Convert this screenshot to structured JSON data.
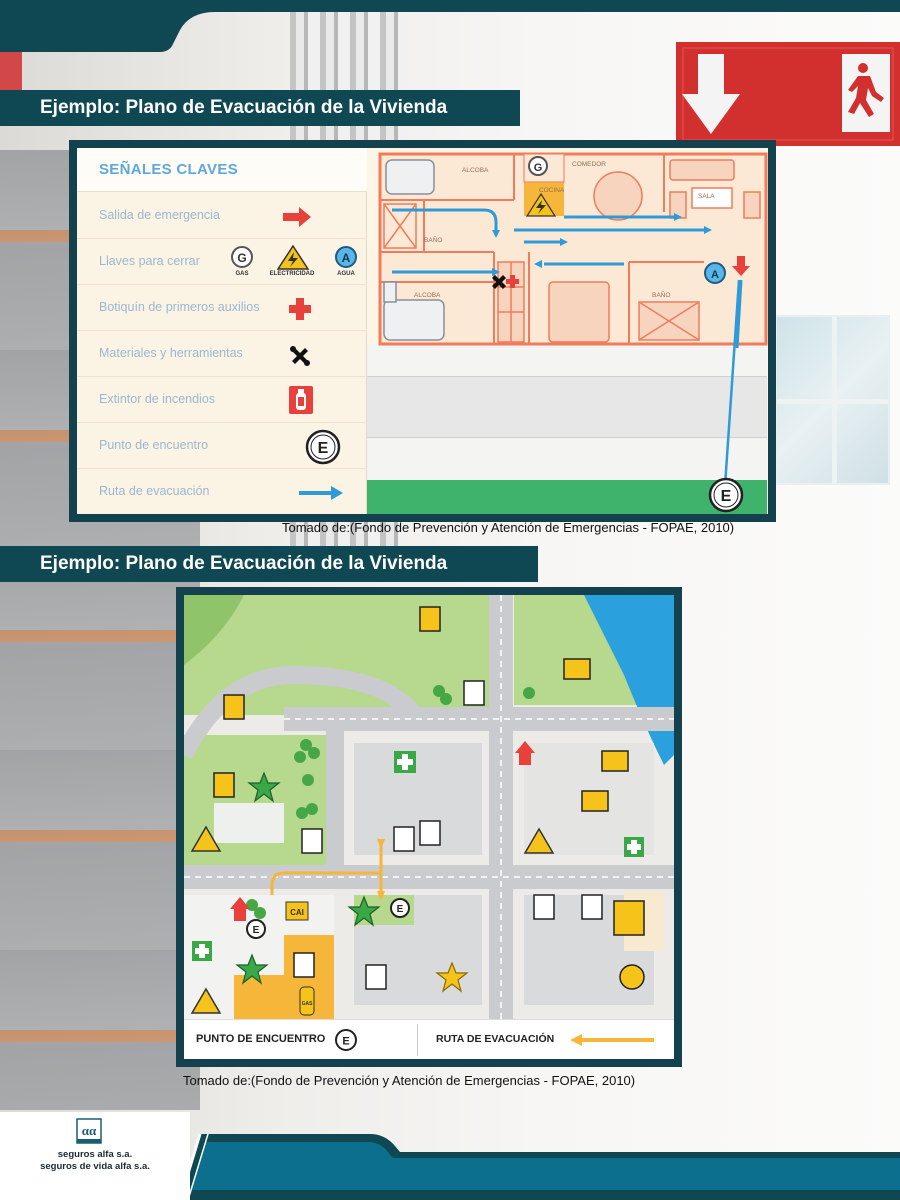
{
  "headers": {
    "section1_title": "Ejemplo: Plano de Evacuación de la Vivienda",
    "section2_title": "Ejemplo: Plano de Evacuación de la Vivienda"
  },
  "legend": {
    "title": "SEÑALES CLAVES",
    "items": [
      {
        "label": "Salida de emergencia",
        "icon": "red-arrow-icon"
      },
      {
        "label": "Llaves para cerrar",
        "icon": "shutoff-keys-icons",
        "sub": [
          "GAS",
          "ELECTRICIDAD",
          "AGUA"
        ]
      },
      {
        "label": "Botiquín de primeros auxilios",
        "icon": "first-aid-cross-icon"
      },
      {
        "label": "Materiales y herramientas",
        "icon": "tools-icon"
      },
      {
        "label": "Extintor de incendios",
        "icon": "fire-extinguisher-icon"
      },
      {
        "label": "Punto de encuentro",
        "icon": "meeting-point-icon",
        "glyph": "E"
      },
      {
        "label": "Ruta de evacuación",
        "icon": "evacuation-route-arrow-icon"
      }
    ]
  },
  "floorplan": {
    "rooms": [
      "ALCOBA",
      "COMEDOR",
      "COCINA",
      "SALA",
      "BAÑO",
      "BAÑO",
      "ALCOBA"
    ],
    "key_labels": {
      "gas": "G",
      "water": "A",
      "meeting": "E"
    }
  },
  "credits": {
    "credit1": "Tomado de:(Fondo de Prevención y Atención de Emergencias - FOPAE, 2010)",
    "credit2": "Tomado de:(Fondo de Prevención y Atención de Emergencias - FOPAE, 2010)"
  },
  "map": {
    "footer_left": "PUNTO DE ENCUENTRO",
    "footer_right": "RUTA DE EVACUACIÓN",
    "meeting_glyph": "E",
    "cai_label": "CAI",
    "gas_label": "GAS"
  },
  "brand": {
    "line1": "seguros alfa s.a.",
    "line2": "seguros de vida alfa s.a.",
    "colors": {
      "primary_dark": "#0f4753",
      "accent_teal": "#0c6f8e",
      "red": "#e8413b",
      "route_blue": "#2f9ad8"
    }
  }
}
